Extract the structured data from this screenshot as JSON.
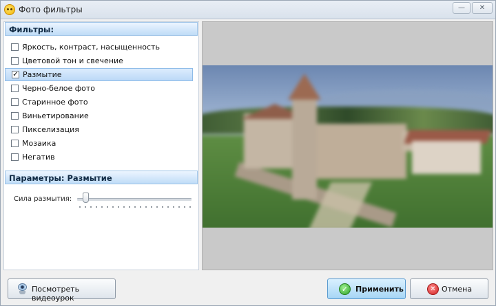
{
  "window": {
    "title": "Фото фильтры",
    "minimize_glyph": "—",
    "close_glyph": "✕"
  },
  "filters": {
    "header": "Фильтры:",
    "items": [
      {
        "label": "Яркость, контраст, насыщенность",
        "checked": false
      },
      {
        "label": "Цветовой тон и свечение",
        "checked": false
      },
      {
        "label": "Размытие",
        "checked": true
      },
      {
        "label": "Черно-белое фото",
        "checked": false
      },
      {
        "label": "Старинное фото",
        "checked": false
      },
      {
        "label": "Виньетирование",
        "checked": false
      },
      {
        "label": "Пикселизация",
        "checked": false
      },
      {
        "label": "Мозаика",
        "checked": false
      },
      {
        "label": "Негатив",
        "checked": false
      }
    ],
    "check_glyph": "✓"
  },
  "params": {
    "header": "Параметры: Размытие",
    "blur_label": "Сила размытия:",
    "blur_value_fraction": 0.05
  },
  "footer": {
    "video_label": "Посмотреть видеоурок",
    "apply_label": "Применить",
    "cancel_label": "Отмена",
    "apply_glyph": "✓",
    "cancel_glyph": "✕"
  },
  "icons": {
    "app": "smiley-app-icon",
    "video": "webcam-icon",
    "apply": "check-circle-icon",
    "cancel": "cancel-circle-icon"
  },
  "colors": {
    "accent": "#bfdcf7",
    "apply_bg": "#a7d6f5",
    "ok_green": "#2ea12a",
    "cancel_red": "#d02020"
  }
}
